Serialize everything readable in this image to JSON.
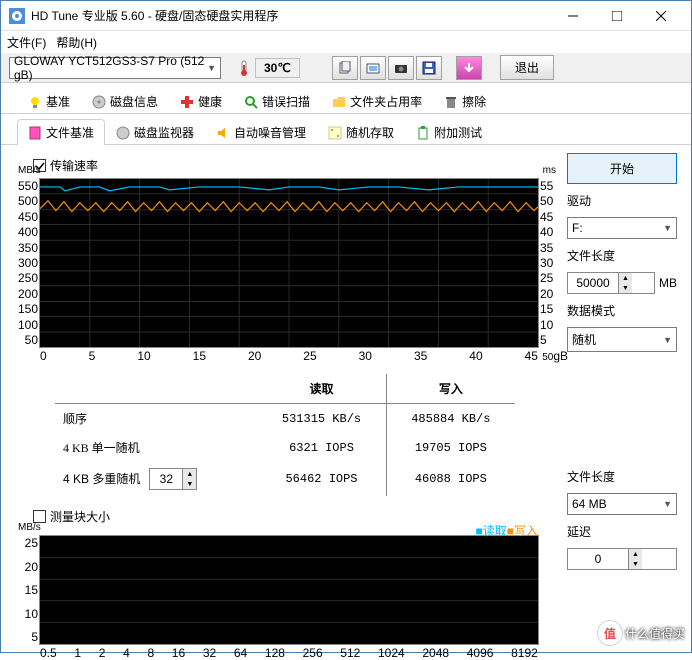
{
  "window": {
    "title": "HD Tune 专业版 5.60 - 硬盘/固态硬盘实用程序"
  },
  "menu": {
    "file": "文件(F)",
    "help": "帮助(H)"
  },
  "toolbar": {
    "drive": "GLOWAY YCT512GS3-S7 Pro (512 gB)",
    "temp": "30℃",
    "exit": "退出"
  },
  "tabs_top": [
    "基准",
    "磁盘信息",
    "健康",
    "错误扫描",
    "文件夹占用率",
    "擦除"
  ],
  "tabs_bot": [
    "文件基准",
    "磁盘监视器",
    "自动噪音管理",
    "随机存取",
    "附加测试"
  ],
  "tabs_active": "文件基准",
  "panel": {
    "chk_transfer": "传输速率",
    "chk_block": "测量块大小",
    "table": {
      "hdr_read": "读取",
      "hdr_write": "写入",
      "rows": [
        {
          "label": "顺序",
          "read": "531315 KB/s",
          "write": "485884 KB/s"
        },
        {
          "label": "4 KB 单一随机",
          "read": "6321 IOPS",
          "write": "19705 IOPS"
        },
        {
          "label": "4 KB 多重随机",
          "read": "56462 IOPS",
          "write": "46088 IOPS"
        }
      ],
      "multi_val": "32"
    },
    "legend_read": "读取",
    "legend_write": "写入"
  },
  "side": {
    "start": "开始",
    "drive_lbl": "驱动",
    "drive_val": "F:",
    "len_lbl": "文件长度",
    "len_val": "50000",
    "len_unit": "MB",
    "mode_lbl": "数据模式",
    "mode_val": "随机",
    "len2_lbl": "文件长度",
    "len2_val": "64 MB",
    "delay_lbl": "延迟",
    "delay_val": "0"
  },
  "chart_data": [
    {
      "type": "line",
      "title": "传输速率",
      "ylabel": "MB/s",
      "ylabel_r": "ms",
      "xlabel": "gB",
      "ylim": [
        0,
        550
      ],
      "ylim_r": [
        0,
        55
      ],
      "xlim": [
        0,
        50
      ],
      "y_ticks": [
        550,
        500,
        450,
        400,
        350,
        300,
        250,
        200,
        150,
        100,
        50
      ],
      "yr_ticks": [
        55,
        50,
        45,
        40,
        35,
        30,
        25,
        20,
        15,
        10,
        5
      ],
      "x_ticks": [
        0,
        5,
        10,
        15,
        20,
        25,
        30,
        35,
        40,
        45,
        50
      ],
      "series": [
        {
          "name": "读取",
          "color": "#00c0ff",
          "approx": 525
        },
        {
          "name": "写入",
          "color": "#ff9000",
          "approx": 460
        }
      ]
    },
    {
      "type": "line",
      "title": "测量块大小",
      "ylabel": "MB/s",
      "xlabel": "",
      "ylim": [
        0,
        25
      ],
      "y_ticks": [
        25,
        20,
        15,
        10,
        5
      ],
      "x_ticks": [
        "0.5",
        "1",
        "2",
        "4",
        "8",
        "16",
        "32",
        "64",
        "128",
        "256",
        "512",
        "1024",
        "2048",
        "4096",
        "8192"
      ],
      "series": [
        {
          "name": "读取",
          "color": "#00c0ff",
          "values": []
        },
        {
          "name": "写入",
          "color": "#ff9000",
          "values": []
        }
      ]
    }
  ],
  "watermark": "什么值得买"
}
